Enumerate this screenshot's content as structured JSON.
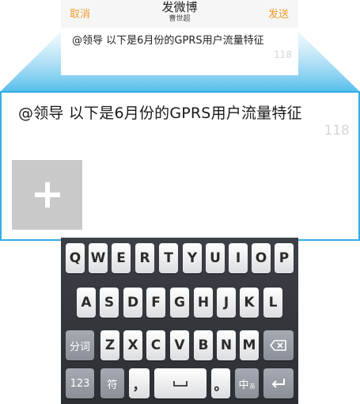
{
  "nav": {
    "cancel_label": "取消",
    "title": "发微博",
    "subtitle": "曹世超",
    "send_label": "发送"
  },
  "compose": {
    "text": "@领导 以下是6月份的GPRS用户流量特征",
    "char_count": "118"
  },
  "colors": {
    "accent": "#f29b2b",
    "zoom_border": "#33aee6"
  },
  "add_photo": {
    "icon": "plus-icon"
  },
  "keyboard": {
    "row1": [
      "Q",
      "W",
      "E",
      "R",
      "T",
      "Y",
      "U",
      "I",
      "O",
      "P"
    ],
    "row2": [
      "A",
      "S",
      "D",
      "F",
      "G",
      "H",
      "J",
      "K",
      "L"
    ],
    "segment_label": "分词",
    "row3": [
      "Z",
      "X",
      "C",
      "V",
      "B",
      "N",
      "M"
    ],
    "backspace_icon": "backspace-icon",
    "numbers_label": "123",
    "symbols_label": "符",
    "comma_label": "，",
    "space_icon": "space-icon",
    "period_label": "。",
    "lang_label": "中",
    "lang_sub_label": "英",
    "return_icon": "return-icon"
  }
}
